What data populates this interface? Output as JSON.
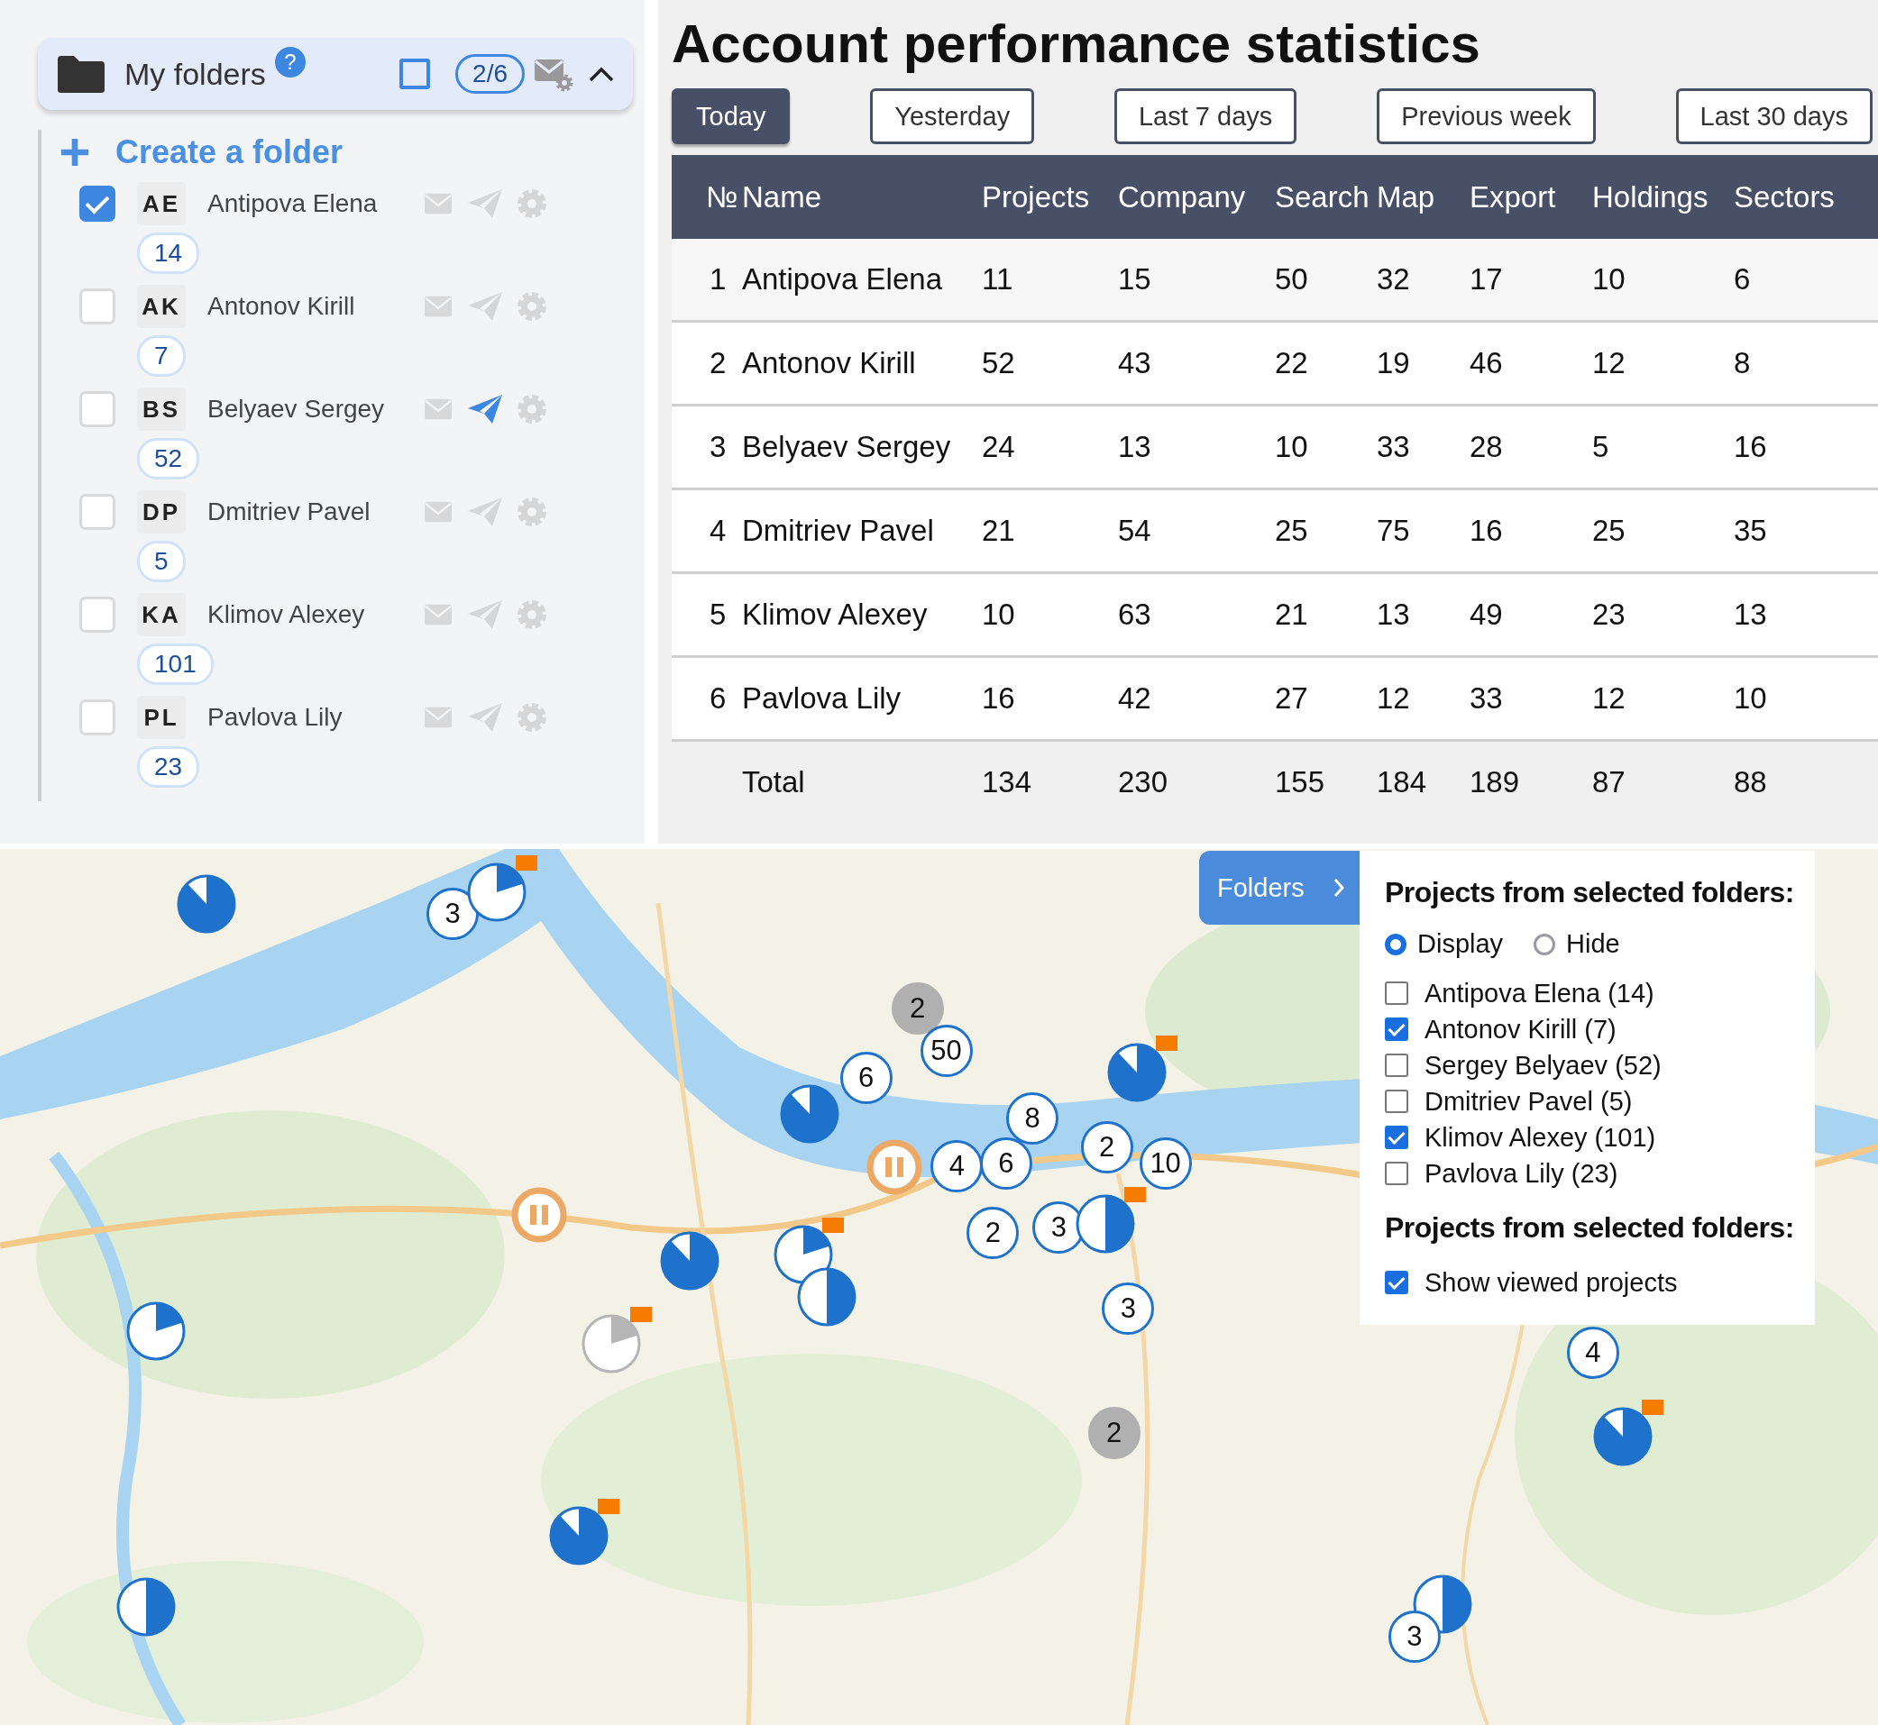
{
  "folders_panel": {
    "title": "My folders",
    "help": "?",
    "select_all": {
      "checked": false
    },
    "counter": "2/6",
    "expanded": true,
    "create_label": "Create a folder",
    "folders": [
      {
        "initials": "AE",
        "name": "Antipova Elena",
        "count": "14",
        "checked": true,
        "send_active": false
      },
      {
        "initials": "AK",
        "name": "Antonov Kirill",
        "count": "7",
        "checked": false,
        "send_active": false
      },
      {
        "initials": "BS",
        "name": "Belyaev Sergey",
        "count": "52",
        "checked": false,
        "send_active": true
      },
      {
        "initials": "DP",
        "name": "Dmitriev Pavel",
        "count": "5",
        "checked": false,
        "send_active": false
      },
      {
        "initials": "KA",
        "name": "Klimov Alexey",
        "count": "101",
        "checked": false,
        "send_active": false
      },
      {
        "initials": "PL",
        "name": "Pavlova Lily",
        "count": "23",
        "checked": false,
        "send_active": false
      }
    ]
  },
  "stats": {
    "title": "Account performance statistics",
    "periods": [
      {
        "label": "Today",
        "selected": true
      },
      {
        "label": "Yesterday",
        "selected": false
      },
      {
        "label": "Last 7 days",
        "selected": false
      },
      {
        "label": "Previous week",
        "selected": false
      },
      {
        "label": "Last 30 days",
        "selected": false
      }
    ],
    "columns": [
      "№",
      "Name",
      "Projects",
      "Company",
      "Search",
      "Map",
      "Export",
      "Holdings",
      "Sectors"
    ],
    "rows": [
      {
        "number": "1",
        "name": "Antipova Elena",
        "values": [
          "11",
          "15",
          "50",
          "32",
          "17",
          "10",
          "6"
        ]
      },
      {
        "number": "2",
        "name": "Antonov Kirill",
        "values": [
          "52",
          "43",
          "22",
          "19",
          "46",
          "12",
          "8"
        ]
      },
      {
        "number": "3",
        "name": "Belyaev Sergey",
        "values": [
          "24",
          "13",
          "10",
          "33",
          "28",
          "5",
          "16"
        ]
      },
      {
        "number": "4",
        "name": "Dmitriev Pavel",
        "values": [
          "21",
          "54",
          "25",
          "75",
          "16",
          "25",
          "35"
        ]
      },
      {
        "number": "5",
        "name": "Klimov Alexey",
        "values": [
          "10",
          "63",
          "21",
          "13",
          "49",
          "23",
          "13"
        ]
      },
      {
        "number": "6",
        "name": "Pavlova Lily",
        "values": [
          "16",
          "42",
          "27",
          "12",
          "33",
          "12",
          "10"
        ]
      }
    ],
    "total": {
      "label": "Total",
      "values": [
        "134",
        "230",
        "155",
        "184",
        "189",
        "87",
        "88"
      ]
    }
  },
  "map": {
    "kind": "picture",
    "markers": [
      {
        "kind": "pie",
        "flag": false,
        "dimmed": false
      },
      {
        "kind": "cluster",
        "label": "3",
        "dimmed": false
      },
      {
        "kind": "slice",
        "flag": true,
        "dimmed": false
      },
      {
        "kind": "cluster",
        "label": "2",
        "dimmed": true
      },
      {
        "kind": "cluster",
        "label": "50",
        "dimmed": false
      },
      {
        "kind": "cluster",
        "label": "6",
        "dimmed": false
      },
      {
        "kind": "pie",
        "flag": true,
        "dimmed": false
      },
      {
        "kind": "pie",
        "flag": false,
        "dimmed": false
      },
      {
        "kind": "cluster",
        "label": "8",
        "dimmed": false
      },
      {
        "kind": "paused"
      },
      {
        "kind": "cluster",
        "label": "4",
        "dimmed": false
      },
      {
        "kind": "cluster",
        "label": "6",
        "dimmed": false
      },
      {
        "kind": "cluster",
        "label": "2",
        "dimmed": false
      },
      {
        "kind": "cluster",
        "label": "10",
        "dimmed": false
      },
      {
        "kind": "paused"
      },
      {
        "kind": "cluster",
        "label": "2",
        "dimmed": false
      },
      {
        "kind": "cluster",
        "label": "3",
        "dimmed": false
      },
      {
        "kind": "halfpie",
        "flag": true,
        "dimmed": false
      },
      {
        "kind": "pie",
        "flag": false,
        "dimmed": false
      },
      {
        "kind": "slice",
        "flag": true,
        "dimmed": false
      },
      {
        "kind": "halfpie",
        "flag": false,
        "dimmed": false
      },
      {
        "kind": "cluster",
        "label": "3",
        "dimmed": false
      },
      {
        "kind": "slice",
        "flag": false,
        "dimmed": false
      },
      {
        "kind": "slice",
        "flag": true,
        "dimmed": true
      },
      {
        "kind": "cluster",
        "label": "4",
        "dimmed": false
      },
      {
        "kind": "cluster",
        "label": "2",
        "dimmed": true
      },
      {
        "kind": "pie",
        "flag": true,
        "dimmed": false
      },
      {
        "kind": "pie",
        "flag": true,
        "dimmed": false
      },
      {
        "kind": "halfpie",
        "flag": false,
        "dimmed": false
      },
      {
        "kind": "halfpie",
        "flag": false,
        "dimmed": false
      },
      {
        "kind": "cluster",
        "label": "3",
        "dimmed": false
      }
    ],
    "folders_button": {
      "label": "Folders"
    },
    "legend": {
      "heading": "Projects from selected folders:",
      "visibility": [
        {
          "label": "Display",
          "selected": true
        },
        {
          "label": "Hide",
          "selected": false
        }
      ],
      "folders": [
        {
          "label": "Antipova Elena (14)",
          "checked": false
        },
        {
          "label": "Antonov Kirill (7)",
          "checked": true
        },
        {
          "label": "Sergey Belyaev (52)",
          "checked": false
        },
        {
          "label": "Dmitriev Pavel (5)",
          "checked": false
        },
        {
          "label": "Klimov Alexey (101)",
          "checked": true
        },
        {
          "label": "Pavlova Lily (23)",
          "checked": false
        }
      ],
      "heading_2": "Projects from selected folders:",
      "show_viewed": {
        "label": "Show viewed projects",
        "checked": true
      }
    }
  }
}
